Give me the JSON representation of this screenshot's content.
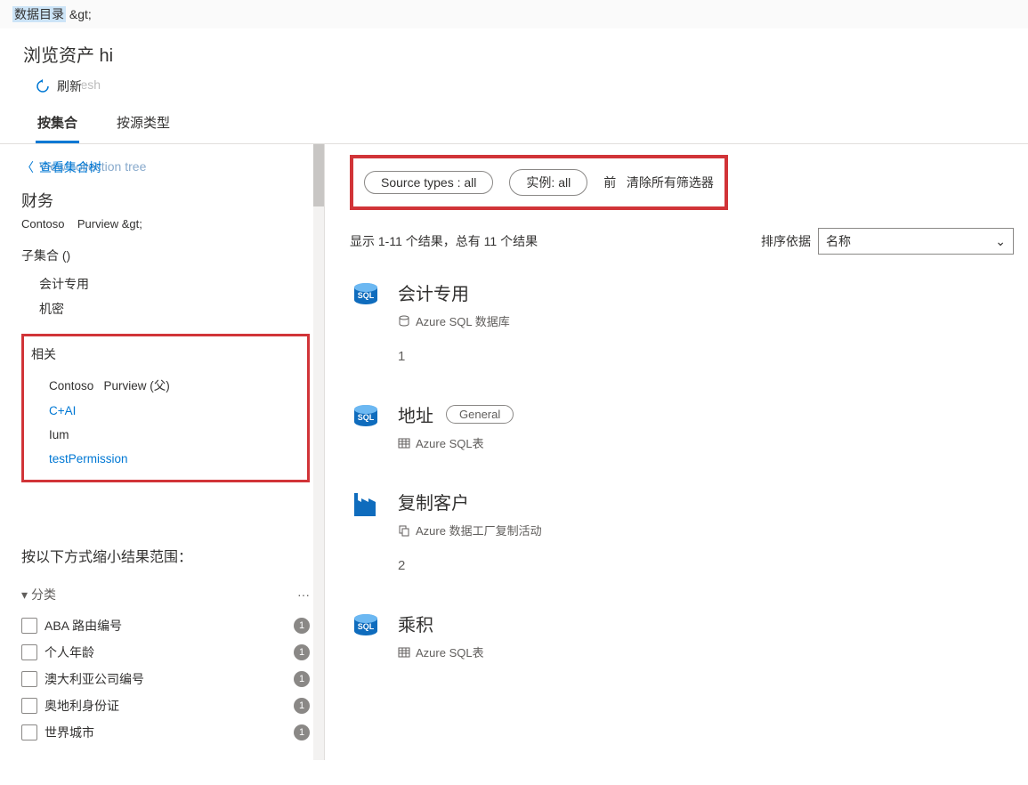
{
  "topbar": {
    "breadcrumb_part1": "数据目录",
    "breadcrumb_part2": " &gt;"
  },
  "title": "浏览资产 hi",
  "refresh": {
    "label": "刷新",
    "shadow": "Refresh"
  },
  "tabs": {
    "by_collection": "按集合",
    "by_source_type": "按源类型"
  },
  "sidebar": {
    "back_link": "查看集合树",
    "back_shadow": "View collection tree",
    "collection_title": "财务",
    "collection_path": "Contoso    Purview &gt;",
    "subcollections_label": "子集合 ()",
    "subcollections": {
      "item1": "会计专用",
      "item2": "机密"
    },
    "related_label": "相关",
    "related": {
      "item1": "Contoso   Purview (父)",
      "item2": "C+AI",
      "item3": "Ium",
      "item4": "testPermission"
    },
    "narrow_label": "按以下方式缩小结果范围：",
    "facet_category": "分类",
    "facets": [
      {
        "label": "ABA 路由编号",
        "count": "1"
      },
      {
        "label": "个人年龄",
        "count": "1"
      },
      {
        "label": "澳大利亚公司编号",
        "count": "1"
      },
      {
        "label": "奥地利身份证",
        "count": "1"
      },
      {
        "label": "世界城市",
        "count": "1"
      }
    ]
  },
  "main": {
    "filter1_label": "Source types :",
    "filter1_value": "all",
    "filter2_label": "实例:",
    "filter2_value": "all",
    "clear_prefix": "前",
    "clear_all": "清除所有筛选器",
    "results_info": "显示 1-11 个结果，总有 11 个结果",
    "sort_label": "排序依据",
    "sort_value": "名称",
    "assets": [
      {
        "title": "会计专用",
        "subtype": "Azure SQL 数据库",
        "icon": "sql",
        "subicon": "db",
        "num": "1",
        "tag": ""
      },
      {
        "title": "地址",
        "subtype": "Azure SQL表",
        "icon": "sql",
        "subicon": "table",
        "num": "",
        "tag": "General"
      },
      {
        "title": "复制客户",
        "subtype": "Azure 数据工厂复制活动",
        "icon": "factory",
        "subicon": "copy",
        "num": "2",
        "tag": ""
      },
      {
        "title": "乘积",
        "subtype": "Azure SQL表",
        "icon": "sql",
        "subicon": "table",
        "num": "",
        "tag": ""
      }
    ]
  }
}
